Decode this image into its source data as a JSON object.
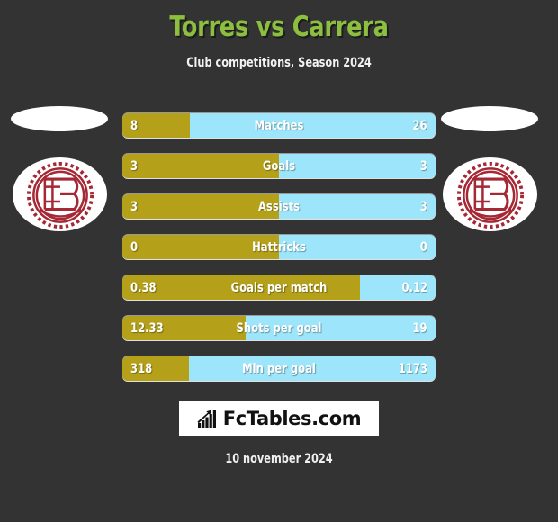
{
  "header": {
    "title": "Torres vs Carrera",
    "subtitle": "Club competitions, Season 2024",
    "title_color": "#8cbf3f"
  },
  "theme": {
    "background": "#333333",
    "home_color": "#b5a01a",
    "away_color": "#9ce5fa",
    "crest_color": "#a52834",
    "text_color": "#ffffff"
  },
  "crests": {
    "left": {
      "name": "club-crest-home",
      "alt_shape": "placeholder-ellipse"
    },
    "right": {
      "name": "club-crest-away",
      "alt_shape": "placeholder-ellipse"
    }
  },
  "stats": [
    {
      "label": "Matches",
      "home": "8",
      "away": "26",
      "home_pct": 21.5
    },
    {
      "label": "Goals",
      "home": "3",
      "away": "3",
      "home_pct": 50
    },
    {
      "label": "Assists",
      "home": "3",
      "away": "3",
      "home_pct": 50
    },
    {
      "label": "Hattricks",
      "home": "0",
      "away": "0",
      "home_pct": 50
    },
    {
      "label": "Goals per match",
      "home": "0.38",
      "away": "0.12",
      "home_pct": 76
    },
    {
      "label": "Shots per goal",
      "home": "12.33",
      "away": "19",
      "home_pct": 39.4
    },
    {
      "label": "Min per goal",
      "home": "318",
      "away": "1173",
      "home_pct": 21.3
    }
  ],
  "footer": {
    "brand": "FcTables.com",
    "brand_icon": "bar-chart-growth-icon",
    "date": "10 november 2024"
  }
}
